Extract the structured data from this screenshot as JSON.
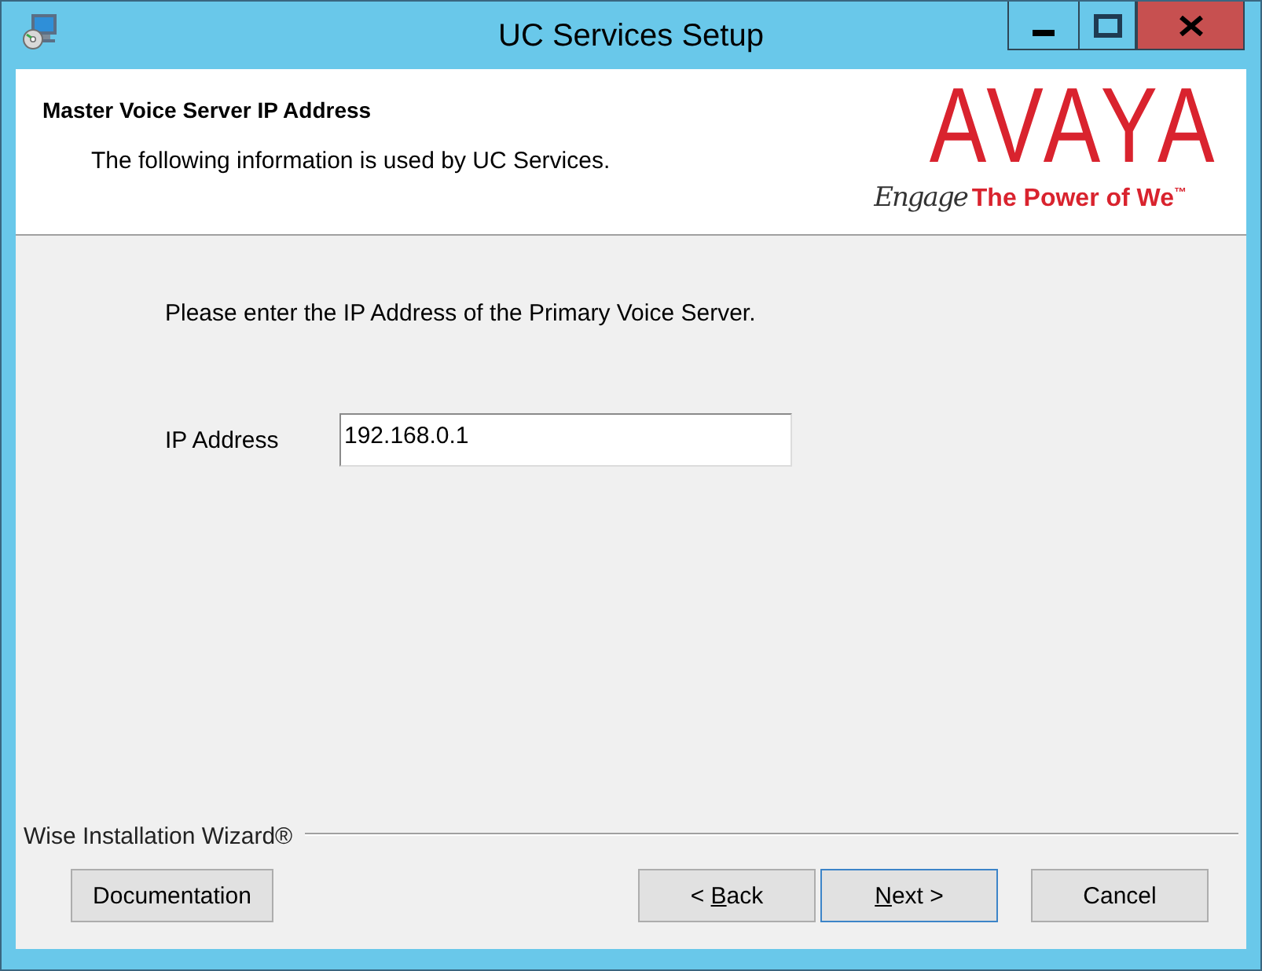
{
  "window": {
    "title": "UC Services Setup"
  },
  "header": {
    "title": "Master Voice Server IP Address",
    "subtitle": "The following information is used by UC Services.",
    "logo": {
      "wordmark": "AVAYA",
      "script": "Engage",
      "tagline": "The Power of We$^{™}$"
    }
  },
  "body": {
    "prompt": "Please enter the IP Address of the Primary Voice Server.",
    "fields": [
      {
        "label": "IP Address",
        "value": "192.168.0.1"
      }
    ]
  },
  "footer": {
    "brand": "Wise Installation Wizard®",
    "buttons": [
      {
        "label": [
          {
            "text": "Documentation",
            "underlined": false
          }
        ],
        "default": false
      },
      {
        "label": [
          {
            "text": "< ",
            "underlined": false
          },
          {
            "text": "B",
            "underlined": true
          },
          {
            "text": "ack",
            "underlined": false
          }
        ],
        "default": false
      },
      {
        "label": [
          {
            "text": "N",
            "underlined": true
          },
          {
            "text": "ext >",
            "underlined": false
          }
        ],
        "default": true
      },
      {
        "label": [
          {
            "text": "Cancel",
            "underlined": false
          }
        ],
        "default": false
      }
    ]
  }
}
